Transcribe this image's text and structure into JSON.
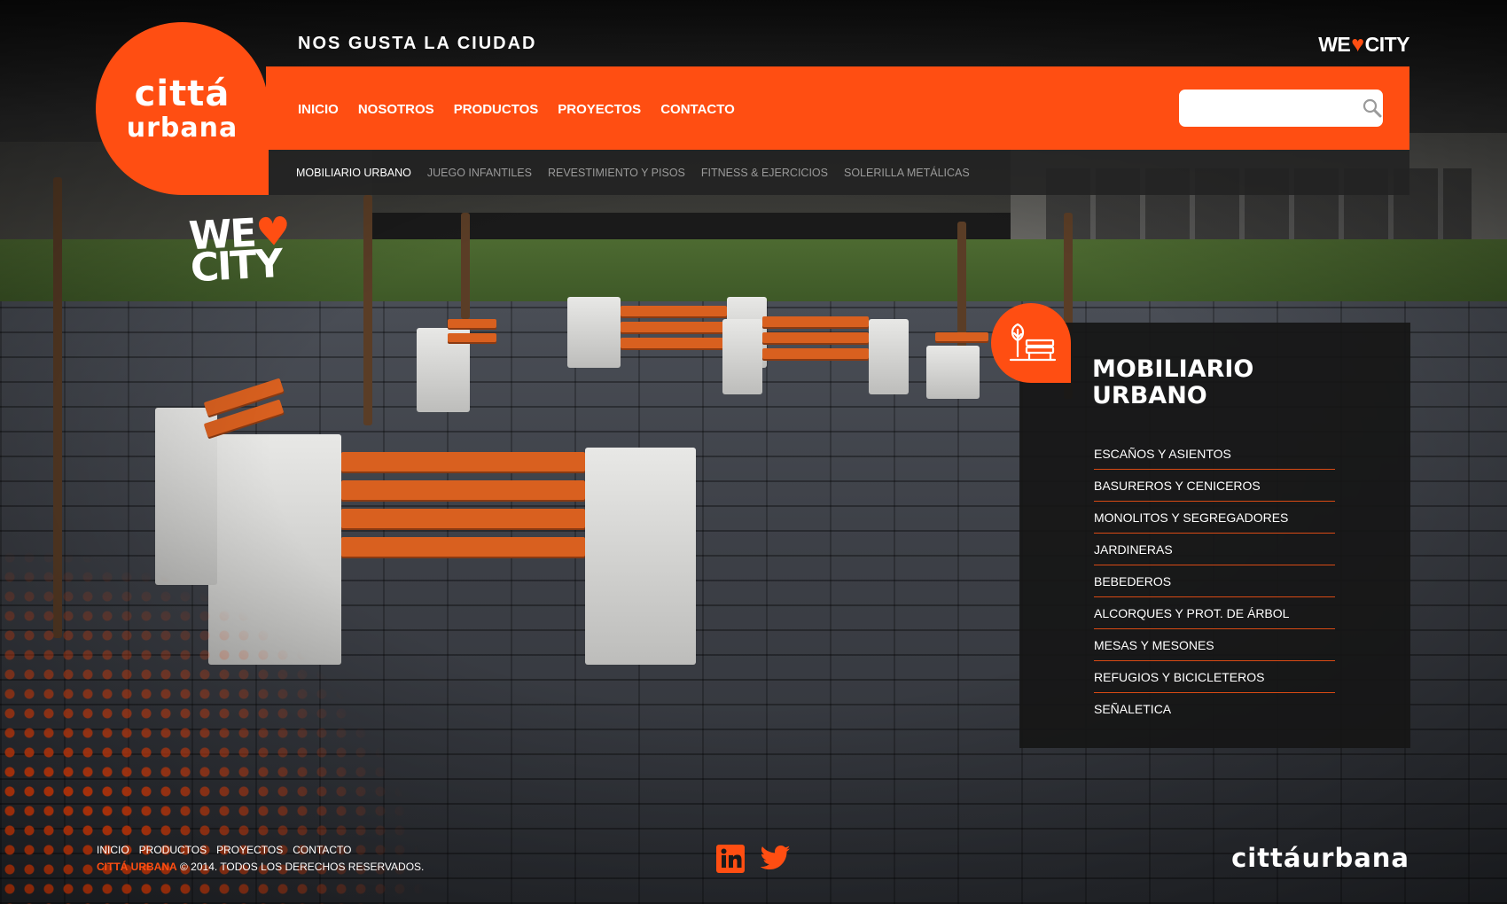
{
  "brand": {
    "logo_line1": "cittá",
    "logo_line2": "urbana",
    "tagline": "NOS GUSTA LA CIUDAD",
    "wecity_we": "WE",
    "wecity_city": "CITY",
    "accent_color": "#ff4e12"
  },
  "main_nav": {
    "items": [
      "INICIO",
      "NOSOTROS",
      "PRODUCTOS",
      "PROYECTOS",
      "CONTACTO"
    ]
  },
  "search": {
    "value": "",
    "placeholder": "",
    "icon": "search-icon"
  },
  "sub_nav": {
    "items": [
      "MOBILIARIO URBANO",
      "JUEGO INFANTILES",
      "REVESTIMIENTO Y PISOS",
      "FITNESS & EJERCICIOS",
      "SOLERILLA METÁLICAS"
    ],
    "active_index": 0
  },
  "hero_badge": {
    "we": "WE",
    "city": "CITY"
  },
  "category_panel": {
    "icon": "park-bench-icon",
    "title_line1": "MOBILIARIO",
    "title_line2": "URBANO",
    "items": [
      "ESCAÑOS Y ASIENTOS",
      "BASUREROS Y CENICEROS",
      "MONOLITOS Y SEGREGADORES",
      "JARDINERAS",
      "BEBEDEROS",
      "ALCORQUES Y PROT. DE ÁRBOL",
      "MESAS Y MESONES",
      "REFUGIOS Y BICICLETEROS",
      "SEÑALETICA"
    ]
  },
  "footer": {
    "links": [
      "INICIO",
      "PRODUCTOS",
      "PROYECTOS",
      "CONTACTO"
    ],
    "copyright_brand": "CITTÁ URBANA",
    "copyright_text": "© 2014. TODOS LOS DERECHOS RESERVADOS.",
    "social": [
      "linkedin-icon",
      "twitter-icon"
    ],
    "logo_text_1": "cittá",
    "logo_text_2": "urbana"
  }
}
